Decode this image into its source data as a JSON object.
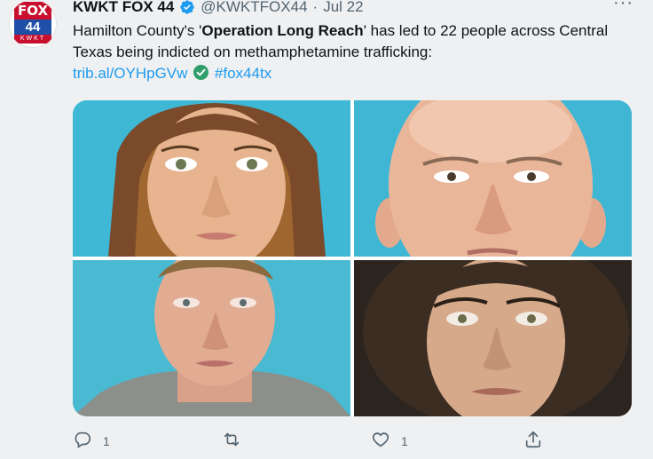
{
  "author": {
    "name": "KWKT FOX 44",
    "handle": "@KWKTFOX44",
    "separator": "·",
    "date": "Jul 22",
    "avatar_logo": {
      "top": "FOX",
      "mid": "44",
      "bottom": "KWKT"
    }
  },
  "more_label": "···",
  "tweet": {
    "text_before": "Hamilton County's '",
    "text_bold": "Operation Long Reach",
    "text_after": "' has led to 22 people across Central Texas being indicted on methamphetamine trafficking:",
    "link": "trib.al/OYHpGVw",
    "hashtag": "#fox44tx"
  },
  "media": {
    "photos": [
      "photo-1",
      "photo-2",
      "photo-3",
      "photo-4"
    ]
  },
  "actions": {
    "reply_count": "1",
    "retweet_count": "",
    "like_count": "1",
    "share_count": ""
  },
  "colors": {
    "accent": "#1d9bf0",
    "verified": "#1d9bf0",
    "text": "#0f1419",
    "muted": "#536471",
    "background": "#eef0f1",
    "check_emoji": "#2e9e6b"
  },
  "icons": {
    "verified": "verified-badge-icon",
    "check": "check-mark-emoji-icon",
    "reply": "reply-icon",
    "retweet": "retweet-icon",
    "like": "heart-icon",
    "share": "share-icon",
    "more": "more-icon"
  }
}
